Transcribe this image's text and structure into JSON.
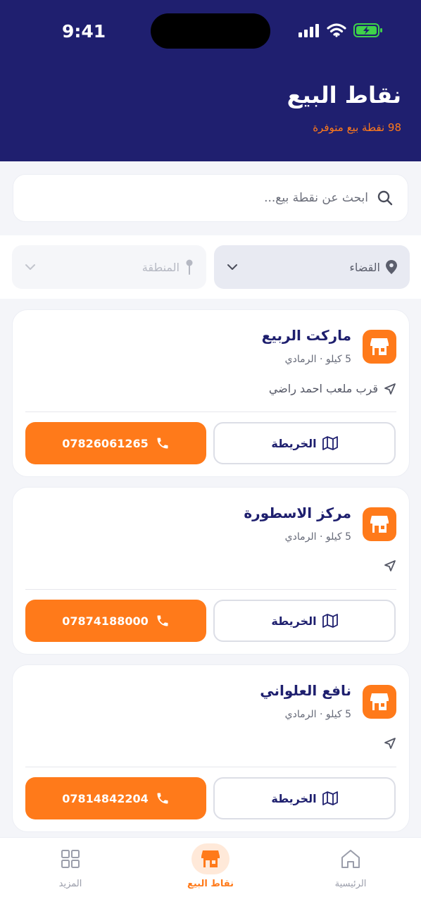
{
  "status_bar": {
    "time": "9:41"
  },
  "header": {
    "title": "نقاط البيع",
    "subtitle": "98 نقطة بيع متوفرة"
  },
  "search": {
    "placeholder": "ابحث عن نقطة بيع...",
    "value": ""
  },
  "filters": {
    "district": {
      "label": "القضاء"
    },
    "region": {
      "label": "المنطقة"
    }
  },
  "points": [
    {
      "name": "ماركت الربيع",
      "distance": "5 كيلو",
      "city": "الرمادي",
      "address": "قرب ملعب احمد راضي",
      "map_label": "الخريطة",
      "phone": "07826061265"
    },
    {
      "name": "مركز الاسطورة",
      "distance": "5 كيلو",
      "city": "الرمادي",
      "address": "",
      "map_label": "الخريطة",
      "phone": "07874188000"
    },
    {
      "name": "نافع العلواني",
      "distance": "5 كيلو",
      "city": "الرمادي",
      "address": "",
      "map_label": "الخريطة",
      "phone": "07814842204"
    }
  ],
  "tabs": {
    "home": {
      "label": "الرئيسية",
      "icon": "home-icon"
    },
    "points": {
      "label": "نقاط البيع",
      "icon": "store-icon",
      "active": true
    },
    "more": {
      "label": "المزيد",
      "icon": "grid-icon"
    }
  },
  "colors": {
    "header_bg": "#1f1f6f",
    "accent": "#ff7a1a",
    "text_dark": "#1e1f6e"
  }
}
